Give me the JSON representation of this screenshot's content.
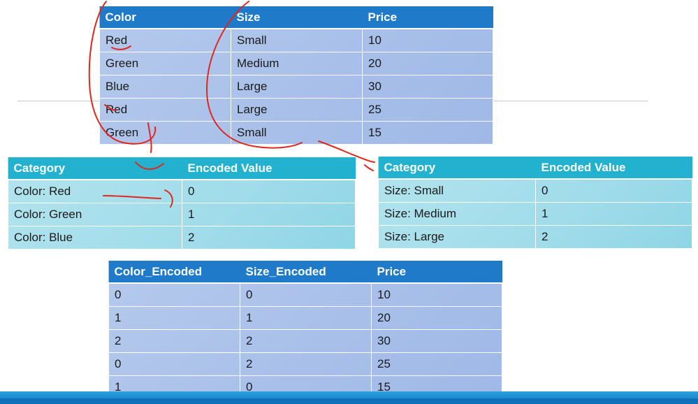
{
  "original_table": {
    "headers": [
      "Color",
      "Size",
      "Price"
    ],
    "rows": [
      [
        "Red",
        "Small",
        "10"
      ],
      [
        "Green",
        "Medium",
        "20"
      ],
      [
        "Blue",
        "Large",
        "30"
      ],
      [
        "Red",
        "Large",
        "25"
      ],
      [
        "Green",
        "Small",
        "15"
      ]
    ]
  },
  "color_mapping": {
    "headers": [
      "Category",
      "Encoded Value"
    ],
    "rows": [
      [
        "Color: Red",
        "0"
      ],
      [
        "Color: Green",
        "1"
      ],
      [
        "Color: Blue",
        "2"
      ]
    ]
  },
  "size_mapping": {
    "headers": [
      "Category",
      "Encoded Value"
    ],
    "rows": [
      [
        "Size: Small",
        "0"
      ],
      [
        "Size: Medium",
        "1"
      ],
      [
        "Size: Large",
        "2"
      ]
    ]
  },
  "encoded_table": {
    "headers": [
      "Color_Encoded",
      "Size_Encoded",
      "Price"
    ],
    "rows": [
      [
        "0",
        "0",
        "10"
      ],
      [
        "1",
        "1",
        "20"
      ],
      [
        "2",
        "2",
        "30"
      ],
      [
        "0",
        "2",
        "25"
      ],
      [
        "1",
        "0",
        "15"
      ]
    ]
  },
  "colors": {
    "blue_header": "#1f7bc9",
    "teal_header": "#22b2cf",
    "annotation_ink": "#e0271e"
  }
}
